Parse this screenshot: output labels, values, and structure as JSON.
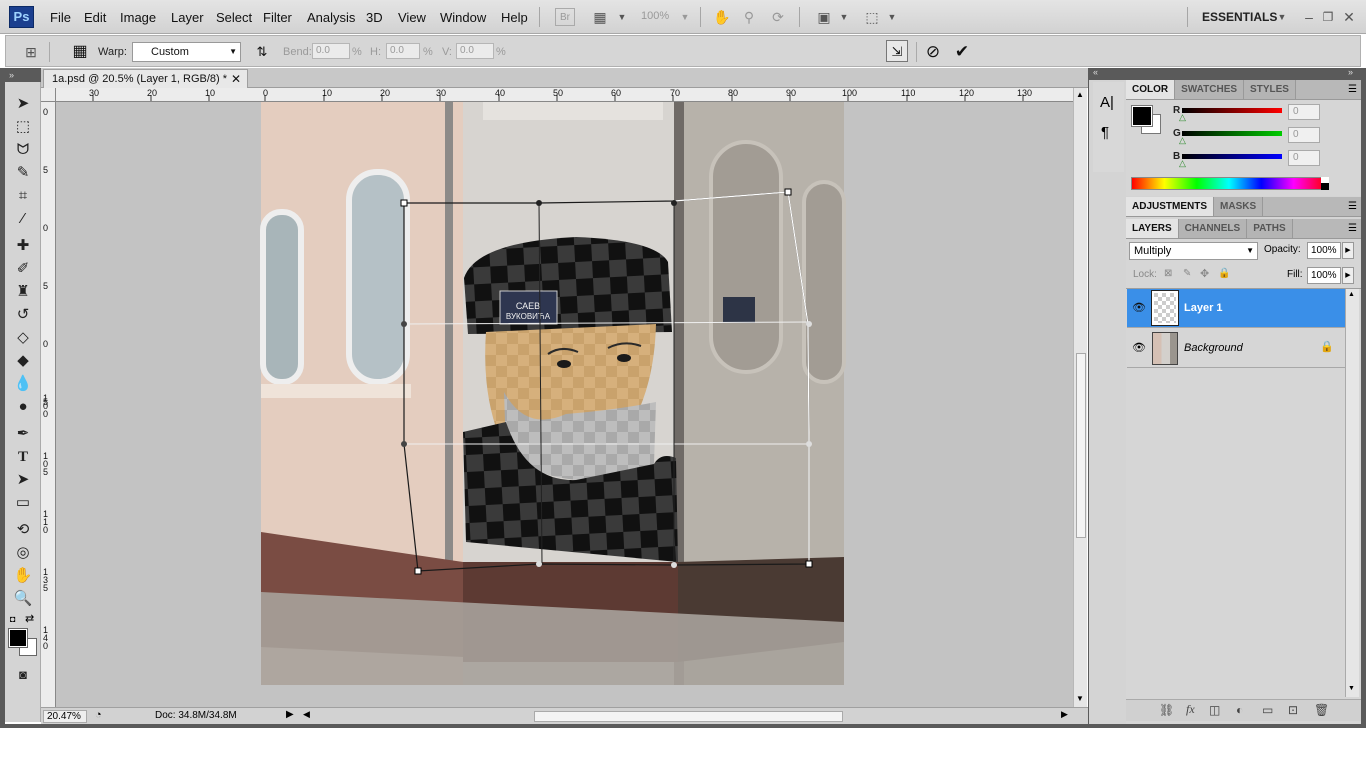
{
  "app": {
    "logo": "Ps"
  },
  "menu": [
    "File",
    "Edit",
    "Image",
    "Layer",
    "Select",
    "Filter",
    "Analysis",
    "3D",
    "View",
    "Window",
    "Help"
  ],
  "menubar_tools": {
    "bridge": "Br",
    "zoom": "100%",
    "workspace": "ESSENTIALS"
  },
  "options": {
    "warp_label": "Warp:",
    "warp_value": "Custom",
    "bend_label": "Bend:",
    "bend_value": "0.0",
    "h_label": "H:",
    "h_value": "0.0",
    "v_label": "V:",
    "v_value": "0.0",
    "pct": "%"
  },
  "document": {
    "tab_title": "1a.psd @ 20.5% (Layer 1, RGB/8) *",
    "ruler_h": [
      "30",
      "20",
      "10",
      "0",
      "10",
      "20",
      "30",
      "40",
      "50",
      "60",
      "70",
      "80",
      "90",
      "100",
      "110",
      "120",
      "130"
    ],
    "ruler_v": [
      "0",
      "5",
      "0",
      "5",
      "0",
      "5",
      "1 0 0",
      "1 0 5",
      "1 1 0",
      "1 3 5",
      "1 4 0"
    ],
    "sign_text": "СAEВ\nВУКОВИЋА"
  },
  "status": {
    "zoom": "20.47%",
    "doc": "Doc: 34.8M/34.8M"
  },
  "color_panel": {
    "tabs": [
      "COLOR",
      "SWATCHES",
      "STYLES"
    ],
    "r_label": "R",
    "r_value": "0",
    "g_label": "G",
    "g_value": "0",
    "b_label": "B",
    "b_value": "0",
    "colors": {
      "red": "#ff0000",
      "green": "#00cc00",
      "blue": "#0000ff"
    }
  },
  "adjust_panel": {
    "tabs": [
      "ADJUSTMENTS",
      "MASKS"
    ]
  },
  "layers_panel": {
    "tabs": [
      "LAYERS",
      "CHANNELS",
      "PATHS"
    ],
    "blend_mode": "Multiply",
    "opacity_label": "Opacity:",
    "opacity_value": "100%",
    "lock_label": "Lock:",
    "fill_label": "Fill:",
    "fill_value": "100%",
    "layers": [
      {
        "name": "Layer 1",
        "selected": true
      },
      {
        "name": "Background",
        "selected": false,
        "locked": true
      }
    ],
    "selection_color": "#3a8fe8"
  }
}
